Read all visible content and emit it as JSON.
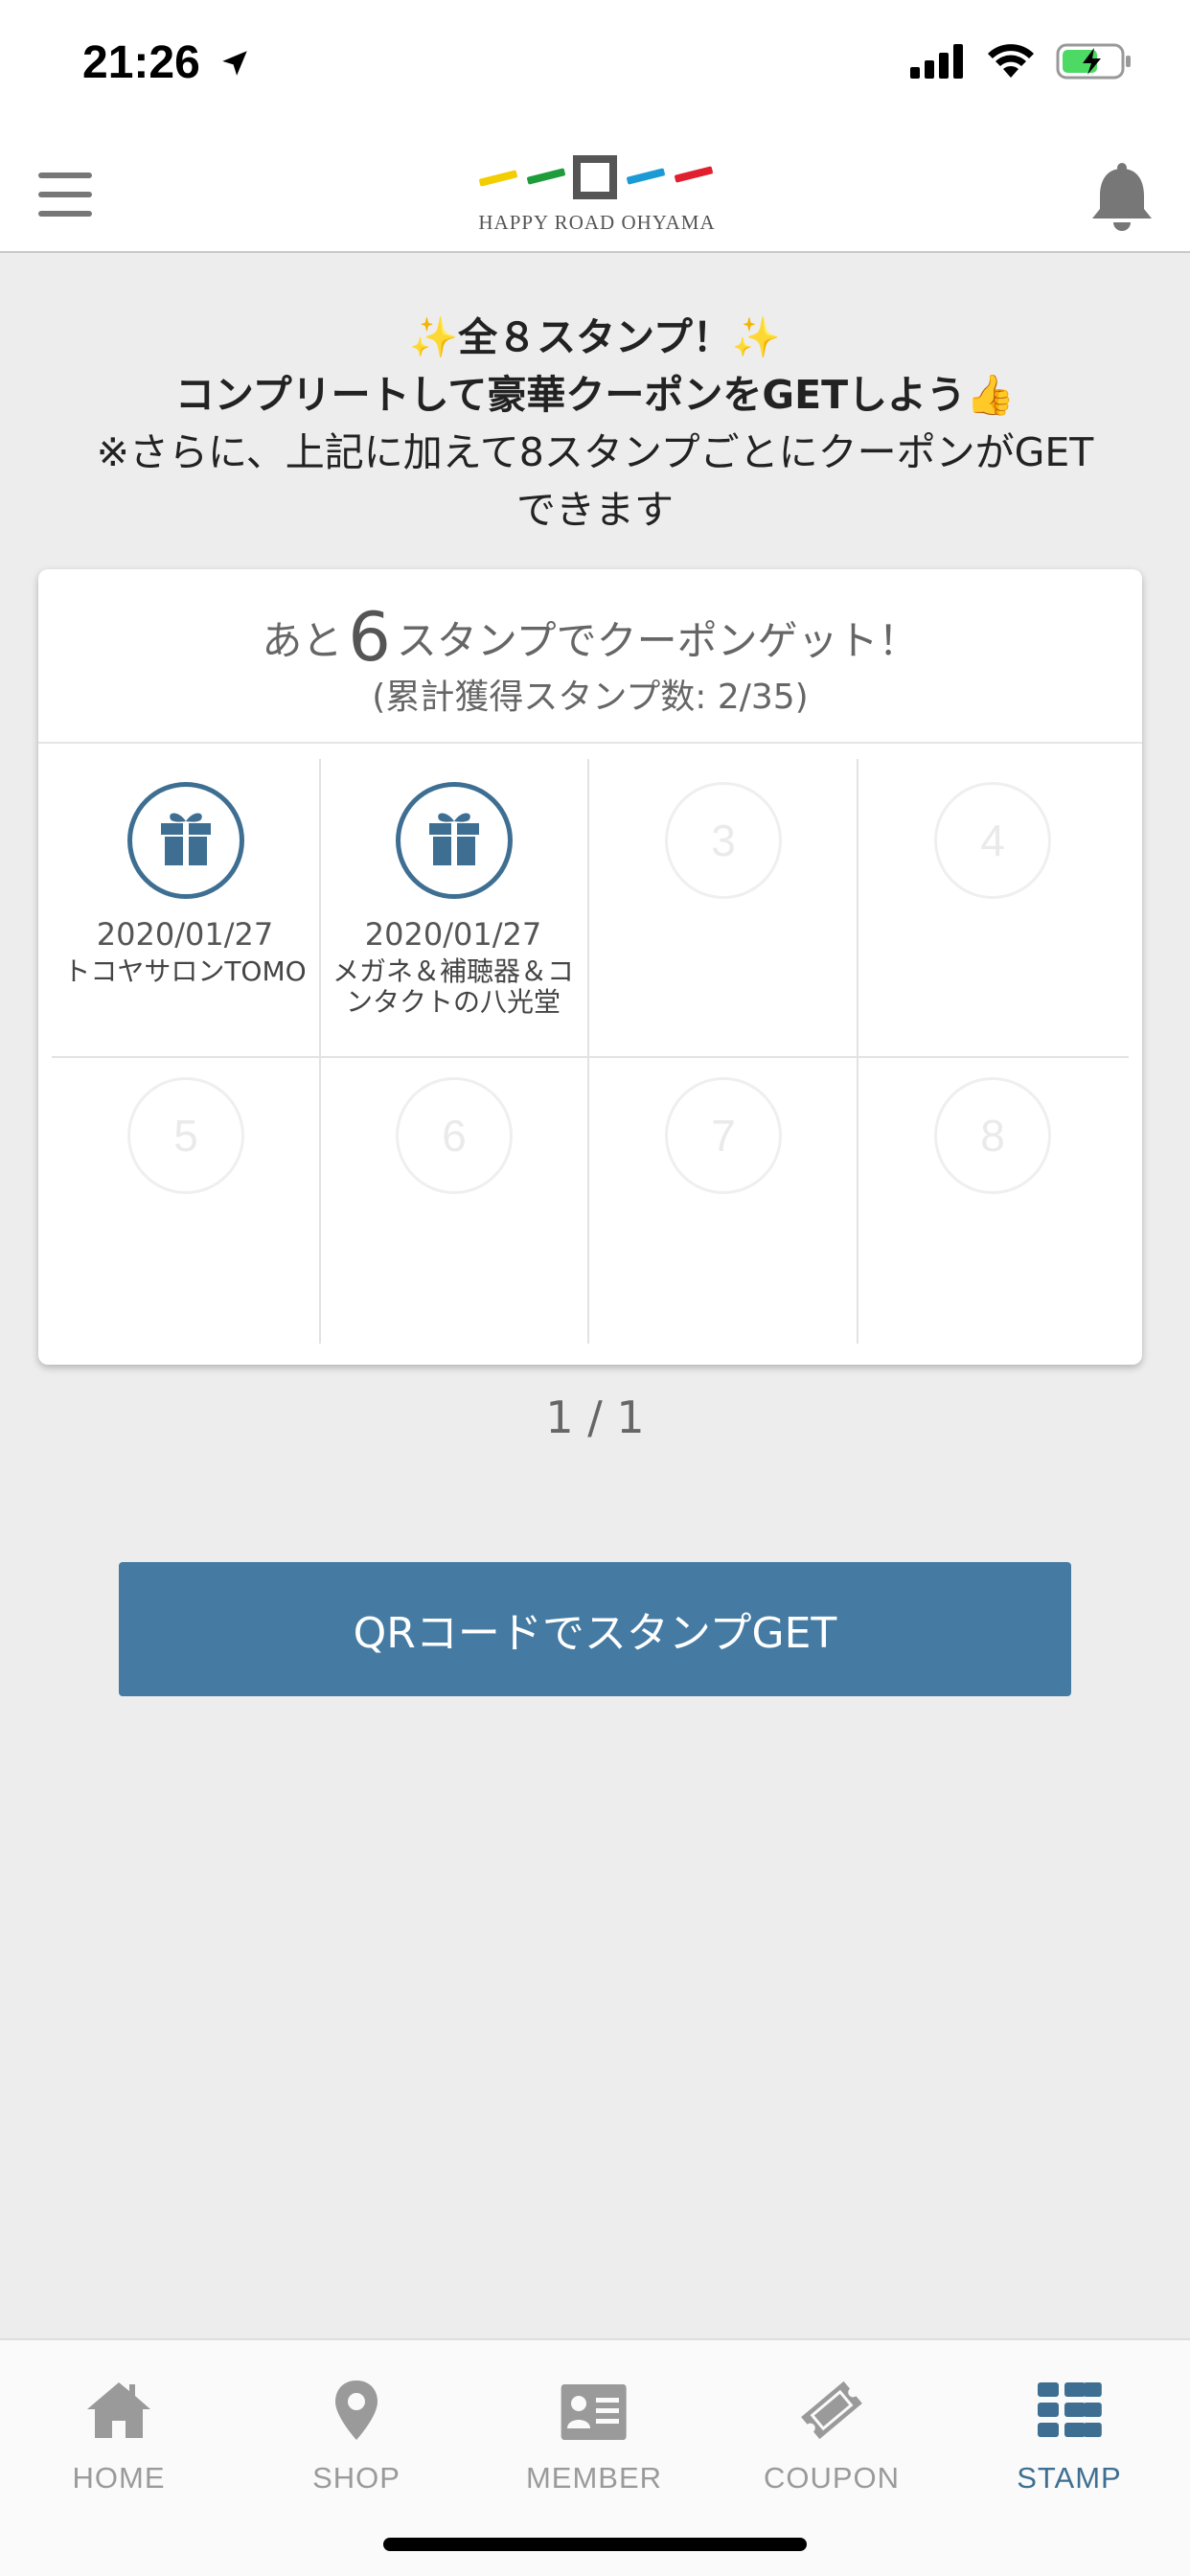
{
  "status": {
    "time": "21:26"
  },
  "header": {
    "logo_text": "HAPPY ROAD OHYAMA"
  },
  "intro": {
    "line1": "✨全８スタンプ！✨",
    "line2": "コンプリートして豪華クーポンをGETしよう👍",
    "line3": "※さらに、上記に加えて8スタンプごとにクーポンがGET",
    "line4": "できます"
  },
  "card": {
    "remaining_prefix": "あと",
    "remaining_count": "6",
    "remaining_suffix": "スタンプでクーポンゲット！",
    "total": "(累計獲得スタンプ数: 2/35)",
    "stamps": [
      {
        "label": "",
        "date": "2020/01/27",
        "shop": "トコヤサロンTOMO",
        "acquired": true
      },
      {
        "label": "",
        "date": "2020/01/27",
        "shop": "メガネ＆補聴器＆コンタクトの八光堂",
        "acquired": true
      },
      {
        "label": "3",
        "date": "",
        "shop": "",
        "acquired": false
      },
      {
        "label": "4",
        "date": "",
        "shop": "",
        "acquired": false
      },
      {
        "label": "5",
        "date": "",
        "shop": "",
        "acquired": false
      },
      {
        "label": "6",
        "date": "",
        "shop": "",
        "acquired": false
      },
      {
        "label": "7",
        "date": "",
        "shop": "",
        "acquired": false
      },
      {
        "label": "8",
        "date": "",
        "shop": "",
        "acquired": false
      }
    ]
  },
  "pagination": "1 / 1",
  "qr_button_label": "QRコードでスタンプGET",
  "tabs": [
    {
      "label": "HOME",
      "icon": "home-icon"
    },
    {
      "label": "SHOP",
      "icon": "map-pin-icon"
    },
    {
      "label": "MEMBER",
      "icon": "member-card-icon"
    },
    {
      "label": "COUPON",
      "icon": "ticket-icon"
    },
    {
      "label": "STAMP",
      "icon": "grid-icon",
      "active": true
    }
  ],
  "colors": {
    "accent": "#3e6f92",
    "button": "#457ba3",
    "background": "#ededed"
  }
}
